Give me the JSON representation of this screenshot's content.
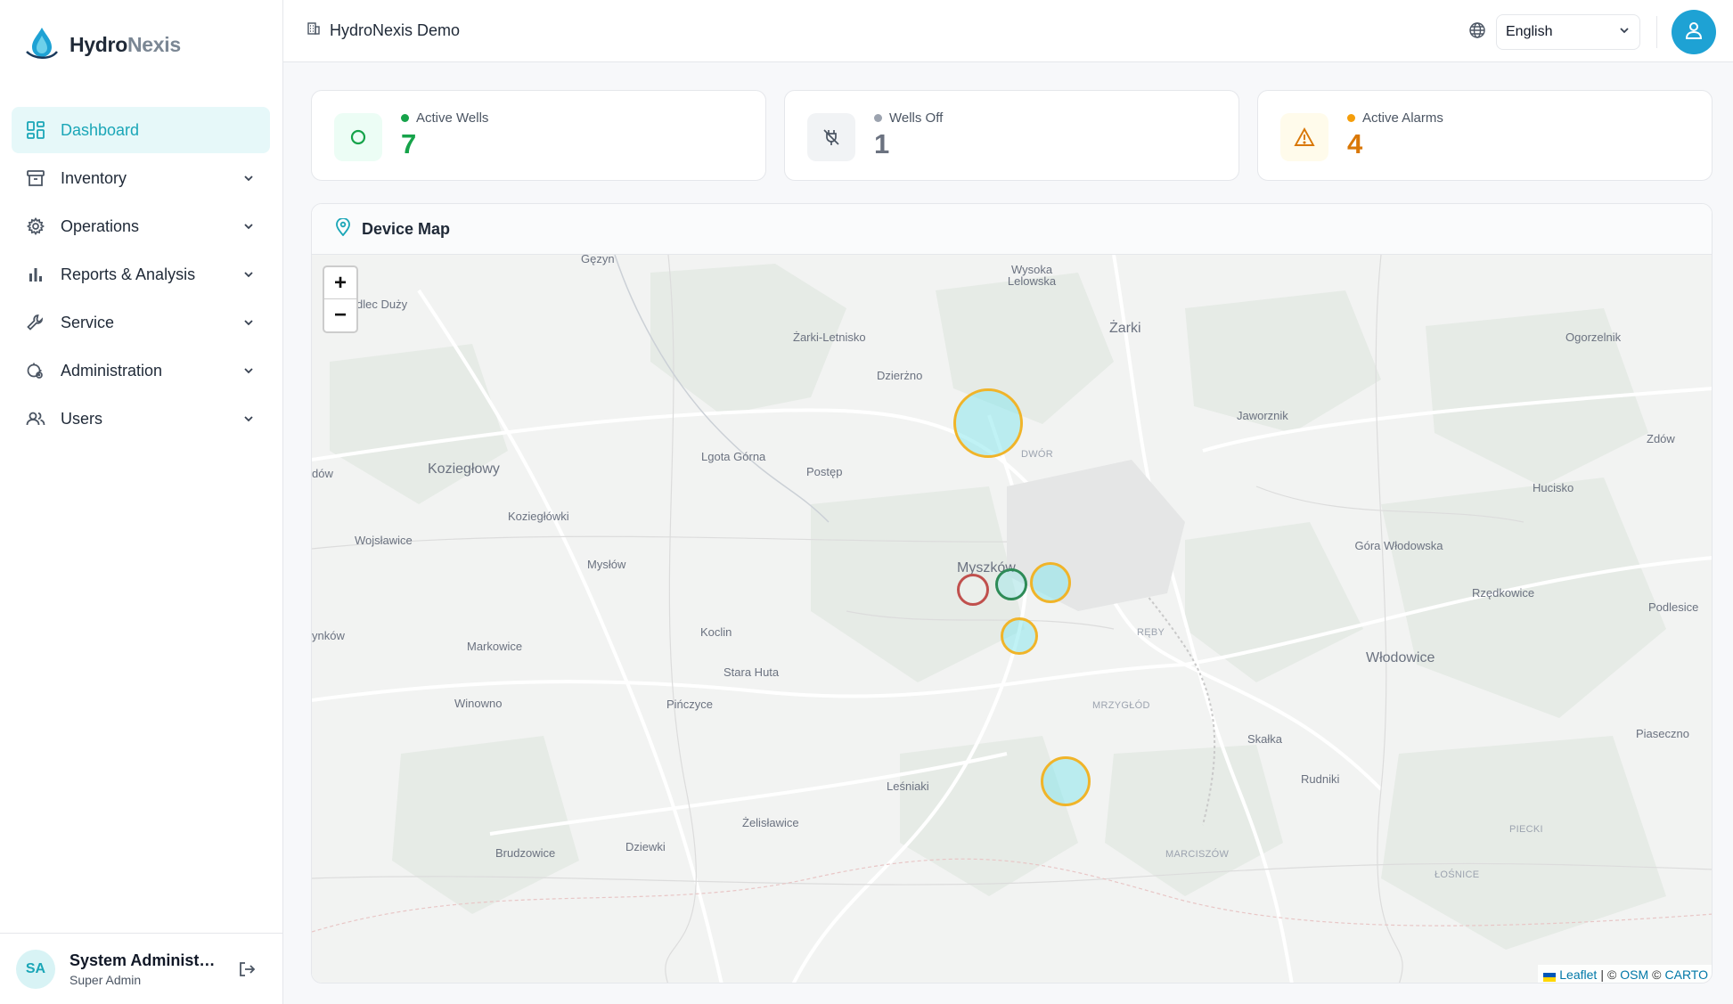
{
  "brand": {
    "name_part1": "Hydro",
    "name_part2": "Nexis"
  },
  "sidebar": {
    "items": [
      {
        "label": "Dashboard",
        "icon": "dashboard-icon",
        "active": true
      },
      {
        "label": "Inventory",
        "icon": "archive-icon"
      },
      {
        "label": "Operations",
        "icon": "gear-icon"
      },
      {
        "label": "Reports & Analysis",
        "icon": "bar-chart-icon"
      },
      {
        "label": "Service",
        "icon": "wrench-icon"
      },
      {
        "label": "Administration",
        "icon": "admin-settings-icon"
      },
      {
        "label": "Users",
        "icon": "users-icon"
      }
    ]
  },
  "user": {
    "initials": "SA",
    "name": "System Administrator",
    "role": "Super Admin"
  },
  "header": {
    "org": "HydroNexis Demo",
    "language": "English"
  },
  "stats": {
    "active_wells": {
      "label": "Active Wells",
      "value": "7",
      "color": "#16a34a"
    },
    "wells_off": {
      "label": "Wells Off",
      "value": "1",
      "color": "#6b7280"
    },
    "active_alarms": {
      "label": "Active Alarms",
      "value": "4",
      "color": "#d97706"
    }
  },
  "map": {
    "title": "Device Map",
    "zoom_in": "+",
    "zoom_out": "−",
    "places": [
      "Gęzyn",
      "dlec Duży",
      "Wysoka Lelowska",
      "Żarki-Letnisko",
      "Żarki",
      "Ogorzelnik",
      "Dzierżno",
      "Jaworznik",
      "Zdów",
      "DWÓR",
      "Lgota Górna",
      "Postęp",
      "dów",
      "Koziegłowy",
      "Hucisko",
      "Koziegłówki",
      "Wojsławice",
      "Mysłów",
      "Myszków",
      "Góra Włodowska",
      "Rzędkowice",
      "Podlesice",
      "ynków",
      "Koclin",
      "RĘBY",
      "Markowice",
      "Włodowice",
      "Stara Huta",
      "Winowno",
      "Pińczyce",
      "MRZYGŁÓD",
      "Piaseczno",
      "Skałka",
      "Leśniaki",
      "Rudniki",
      "Żelisławice",
      "PIECKI",
      "Brudzowice",
      "Dziewki",
      "MARCISZÓW",
      "ŁOŚNICE"
    ],
    "attribution": {
      "leaflet": "Leaflet",
      "osm": "OSM",
      "carto": "CARTO",
      "sep1": "|",
      "copy": "©"
    }
  }
}
